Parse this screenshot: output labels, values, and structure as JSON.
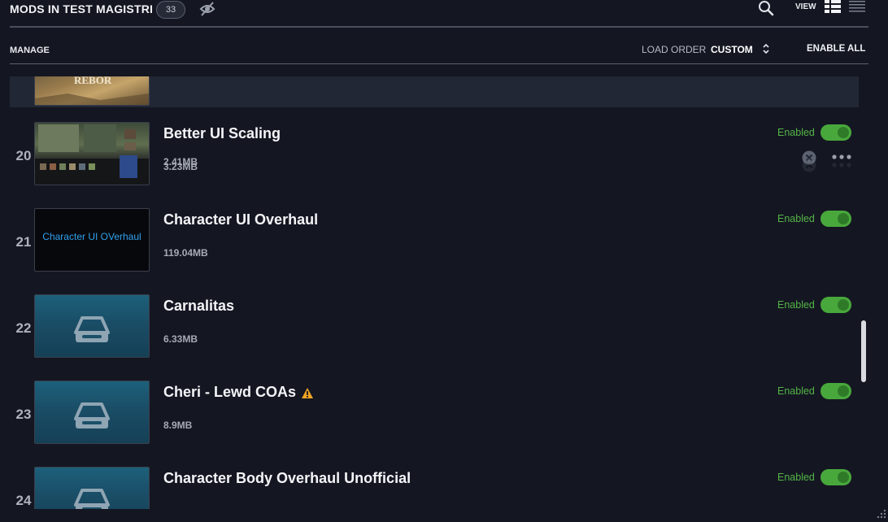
{
  "header": {
    "title": "MODS IN TEST MAGISTRI",
    "count": "33",
    "view_label": "VIEW"
  },
  "toolbar": {
    "manage_label": "MANAGE",
    "load_order_label": "LOAD ORDER",
    "load_order_value": "CUSTOM",
    "enable_all_label": "ENABLE ALL"
  },
  "mods": [
    {
      "index": "",
      "name": "",
      "size": "2.41MB",
      "status": ""
    },
    {
      "index": "20",
      "name": "Better UI Scaling",
      "size": "3.23MB",
      "status": "Enabled"
    },
    {
      "index": "21",
      "name": "Character UI Overhaul",
      "size": "119.04MB",
      "status": "Enabled",
      "thumb_text": "Character UI OVerhaul"
    },
    {
      "index": "22",
      "name": "Carnalitas",
      "size": "6.33MB",
      "status": "Enabled"
    },
    {
      "index": "23",
      "name": "Cheri - Lewd COAs",
      "size": "8.9MB",
      "status": "Enabled"
    },
    {
      "index": "24",
      "name": "Character Body Overhaul Unofficial",
      "size": "",
      "status": "Enabled"
    }
  ],
  "colors": {
    "background": "#141722",
    "enabled_green": "#55b446",
    "toggle_green": "#49a83c",
    "warning_orange": "#f0a323",
    "thumb_text_blue": "#2fa1ee"
  },
  "icons": [
    "hide-icon",
    "search-icon",
    "grid-view-icon",
    "list-view-icon",
    "sort-icon",
    "remove-icon",
    "more-options-icon",
    "warning-icon",
    "drive-icon",
    "resize-grip-icon"
  ]
}
